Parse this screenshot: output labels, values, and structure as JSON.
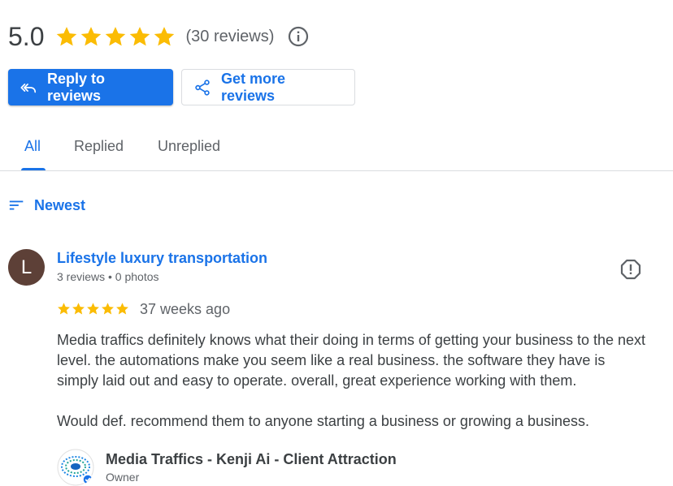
{
  "rating": {
    "score": "5.0",
    "stars": 5,
    "count_text": "(30 reviews)",
    "star_color": "#fbbc04",
    "info_icon": "info-icon"
  },
  "actions": {
    "reply_label": "Reply to reviews",
    "reply_icon": "reply-all-icon",
    "get_more_label": "Get more reviews",
    "get_more_icon": "share-icon"
  },
  "tabs": [
    {
      "label": "All",
      "active": true
    },
    {
      "label": "Replied",
      "active": false
    },
    {
      "label": "Unreplied",
      "active": false
    }
  ],
  "sort": {
    "label": "Newest",
    "icon": "sort-icon"
  },
  "review": {
    "avatar_letter": "L",
    "avatar_color": "#5d4037",
    "reviewer_name": "Lifestyle luxury transportation",
    "reviewer_meta": "3 reviews • 0 photos",
    "stars": 5,
    "time": "37 weeks ago",
    "text_paragraphs": [
      "Media traffics definitely knows what their doing in terms of getting your business to the next level. the automations make you seem like a real business. the software they have is simply laid out and easy to operate. overall, great experience working with them.",
      "Would def. recommend them to anyone starting a business or growing a business."
    ],
    "flag_icon": "report-icon"
  },
  "owner_reply": {
    "name": "Media Traffics - Kenji Ai - Client Attraction",
    "role": "Owner"
  },
  "colors": {
    "accent": "#1a73e8",
    "text_primary": "#202124",
    "text_secondary": "#5f6368",
    "divider": "#dadce0"
  }
}
